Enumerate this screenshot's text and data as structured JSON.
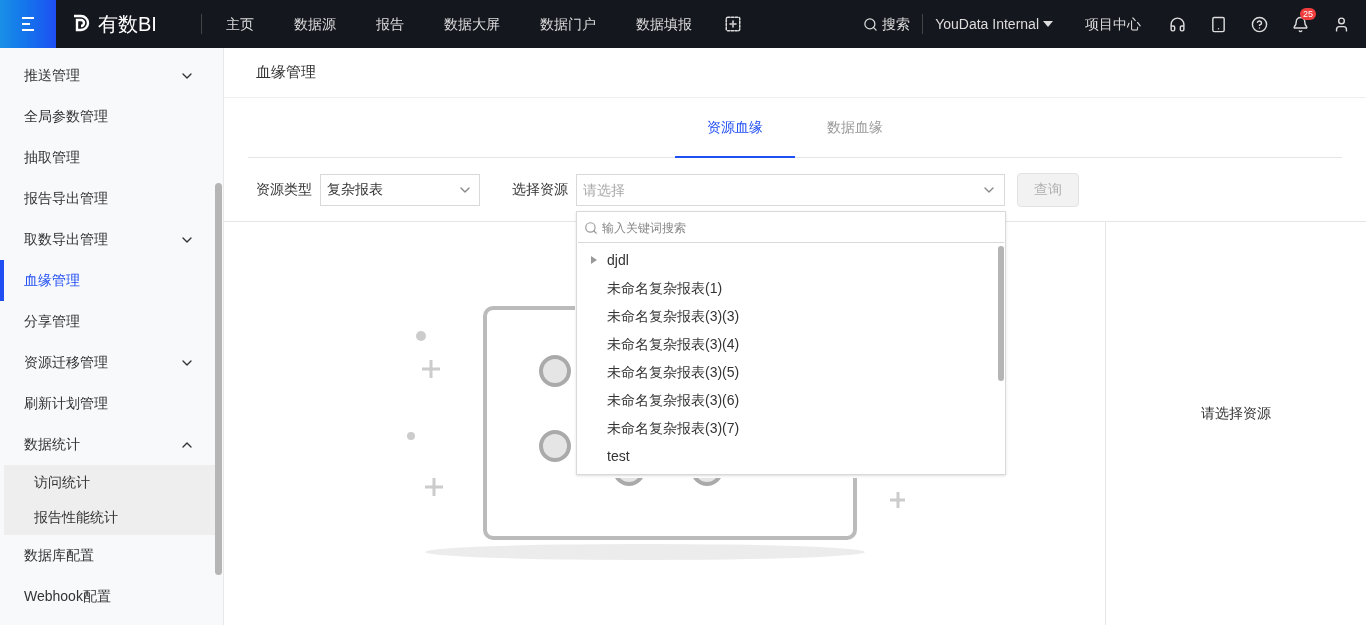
{
  "header": {
    "logo_text": "有数BI",
    "nav": [
      {
        "label": "主页"
      },
      {
        "label": "数据源"
      },
      {
        "label": "报告"
      },
      {
        "label": "数据大屏"
      },
      {
        "label": "数据门户"
      },
      {
        "label": "数据填报"
      }
    ],
    "search": "搜索",
    "workspace": "YouData Internal",
    "project_center": "项目中心",
    "notification_count": "25"
  },
  "sidebar": {
    "items": [
      {
        "label": "推送管理",
        "kind": "group",
        "expanded": false,
        "selected": false
      },
      {
        "label": "全局参数管理",
        "kind": "link",
        "selected": false
      },
      {
        "label": "抽取管理",
        "kind": "link",
        "selected": false
      },
      {
        "label": "报告导出管理",
        "kind": "link",
        "selected": false
      },
      {
        "label": "取数导出管理",
        "kind": "group",
        "expanded": false,
        "selected": false
      },
      {
        "label": "血缘管理",
        "kind": "link",
        "selected": true
      },
      {
        "label": "分享管理",
        "kind": "link",
        "selected": false
      },
      {
        "label": "资源迁移管理",
        "kind": "group",
        "expanded": false,
        "selected": false
      },
      {
        "label": "刷新计划管理",
        "kind": "link",
        "selected": false
      },
      {
        "label": "数据统计",
        "kind": "group",
        "expanded": true,
        "selected": false,
        "children": [
          {
            "label": "访问统计",
            "selected": false
          },
          {
            "label": "报告性能统计",
            "selected": false
          }
        ]
      },
      {
        "label": "数据库配置",
        "kind": "link",
        "selected": false
      },
      {
        "label": "Webhook配置",
        "kind": "link",
        "selected": false
      }
    ]
  },
  "page": {
    "title": "血缘管理",
    "tabs": [
      {
        "label": "资源血缘",
        "selected": true
      },
      {
        "label": "数据血缘",
        "selected": false
      }
    ],
    "filters": {
      "resource_type": {
        "label": "资源类型",
        "value": "复杂报表"
      },
      "resource": {
        "label": "选择资源",
        "placeholder": "请选择"
      },
      "query_button": {
        "label": "查询",
        "disabled": true
      }
    },
    "dropdown": {
      "search_placeholder": "输入关键词搜索",
      "options": [
        {
          "label": "djdl",
          "kind": "folder"
        },
        {
          "label": "未命名复杂报表(1)",
          "kind": "item"
        },
        {
          "label": "未命名复杂报表(3)(3)",
          "kind": "item"
        },
        {
          "label": "未命名复杂报表(3)(4)",
          "kind": "item"
        },
        {
          "label": "未命名复杂报表(3)(5)",
          "kind": "item"
        },
        {
          "label": "未命名复杂报表(3)(6)",
          "kind": "item"
        },
        {
          "label": "未命名复杂报表(3)(7)",
          "kind": "item"
        },
        {
          "label": "test",
          "kind": "item"
        }
      ]
    },
    "right_panel": {
      "message": "请选择资源"
    }
  }
}
